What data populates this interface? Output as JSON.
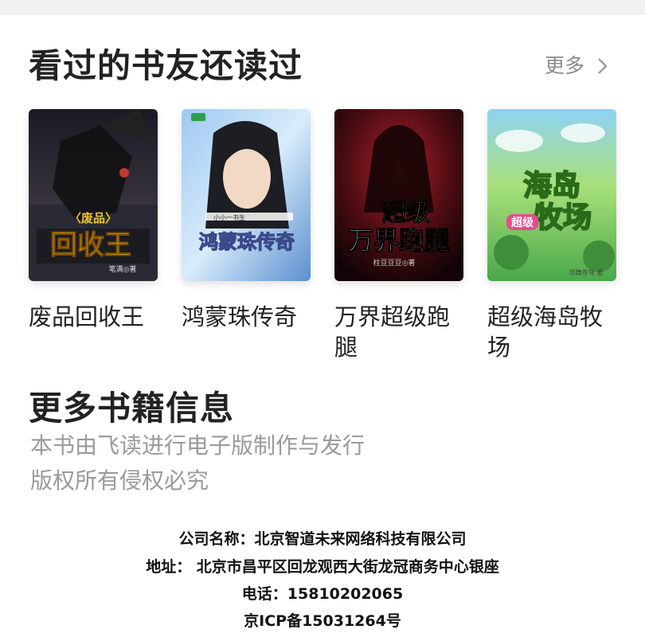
{
  "section": {
    "title": "看过的书友还读过",
    "more_label": "更多"
  },
  "books": [
    {
      "title": "废品回收王",
      "cover_text": "废品 回收王",
      "cover_author": "笔满◎著"
    },
    {
      "title": "鸿蒙珠传奇",
      "cover_text": "鸿蒙珠传奇",
      "cover_author": "小小一书生"
    },
    {
      "title": "万界超级跑腿",
      "cover_text": "超级 万界跑腿",
      "cover_author": "柱豆豆豆◎著"
    },
    {
      "title": "超级海岛牧场",
      "cover_text": "海岛 牧场",
      "cover_badge": "超级",
      "cover_author": "剑舞苍穹 著"
    }
  ],
  "info": {
    "title": "更多书籍信息",
    "line1": "本书由飞读进行电子版制作与发行",
    "line2": "版权所有侵权必究"
  },
  "footer": {
    "company": "公司名称：北京智道未来网络科技有限公司",
    "address": "地址： 北京市昌平区回龙观西大街龙冠商务中心银座",
    "phone": "电话：15810202065",
    "icp": "京ICP备15031264号"
  }
}
